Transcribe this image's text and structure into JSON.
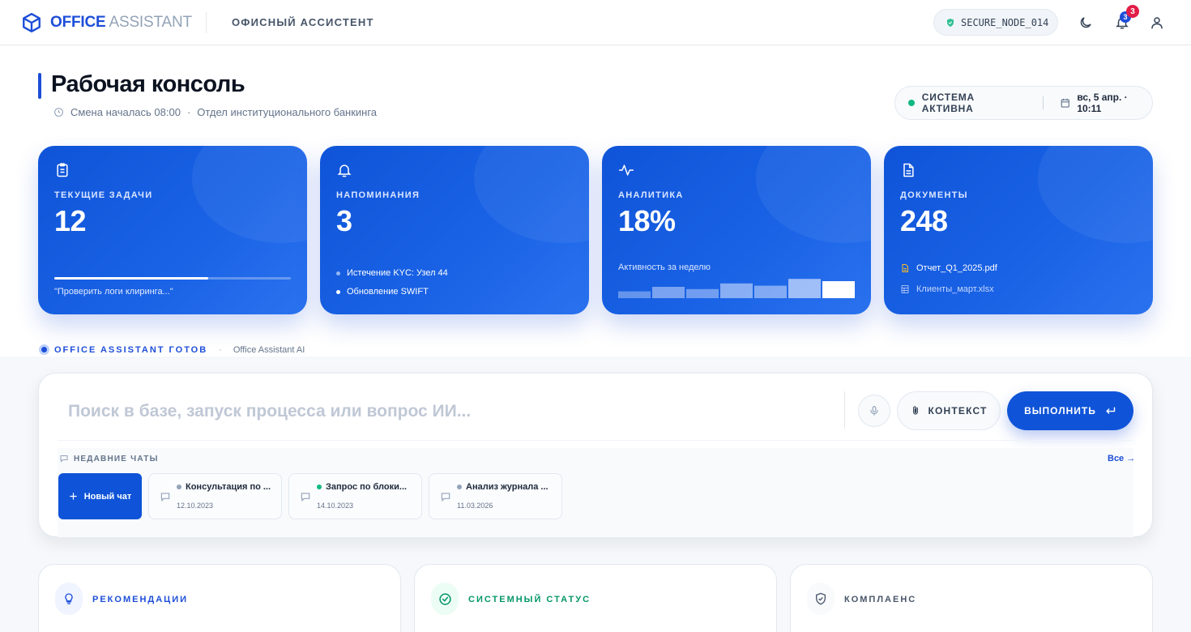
{
  "header": {
    "logo_bold": "OFFICE",
    "logo_light": "ASSISTANT",
    "subtitle": "ОФИСНЫЙ АССИСТЕНТ",
    "node": "SECURE_NODE_014",
    "notification_badge": "3",
    "notification_count": "3"
  },
  "page": {
    "title": "Рабочая консоль",
    "shift": "Смена началась 08:00",
    "dot": "·",
    "department": "Отдел институционального банкинга"
  },
  "status": {
    "text": "СИСТЕМА АКТИВНА",
    "date": "вс, 5 апр. · 10:11",
    "color": "#10b981"
  },
  "cards": {
    "tasks": {
      "label": "ТЕКУЩИЕ ЗАДАЧИ",
      "value": "12",
      "progress": 0.65,
      "note": "\"Проверить логи клиринга...\""
    },
    "reminders": {
      "label": "НАПОМИНАНИЯ",
      "value": "3",
      "items": [
        "Истечение KYC: Узел 44",
        "Обновление SWIFT"
      ]
    },
    "analytics": {
      "label": "АНАЛИТИКА",
      "value": "18%",
      "week_label": "Активность за неделю",
      "week_activity": [
        0.3,
        0.5,
        0.4,
        0.65,
        0.55,
        0.85,
        0.75
      ]
    },
    "documents": {
      "label": "ДОКУМЕНТЫ",
      "value": "248",
      "files": [
        "Отчет_Q1_2025.pdf",
        "Клиенты_март.xlsx"
      ]
    }
  },
  "assistant": {
    "ready": "OFFICE ASSISTANT ГОТОВ",
    "sep": "·",
    "name": "Office Assistant AI"
  },
  "search": {
    "placeholder": "Поиск в базе, запуск процесса или вопрос ИИ...",
    "context_label": "КОНТЕКСТ",
    "run_label": "ВЫПОЛНИТЬ"
  },
  "chats": {
    "heading": "НЕДАВНИЕ ЧАТЫ",
    "all_label": "Все →",
    "new_label": "Новый чат",
    "items": [
      {
        "title": "Консультация по ...",
        "date": "12.10.2023",
        "dot": "#94a3b8"
      },
      {
        "title": "Запрос по блоки...",
        "date": "14.10.2023",
        "dot": "#10b981"
      },
      {
        "title": "Анализ журнала ...",
        "date": "11.03.2026",
        "dot": "#94a3b8"
      }
    ]
  },
  "bottom": {
    "recommendations": "РЕКОМЕНДАЦИИ",
    "system_status": "СИСТЕМНЫЙ СТАТУС",
    "compliance": "КОМПЛАЕНС"
  },
  "colors": {
    "accent": "#1d4ed8",
    "success": "#10b981",
    "alert": "#e11d48"
  }
}
